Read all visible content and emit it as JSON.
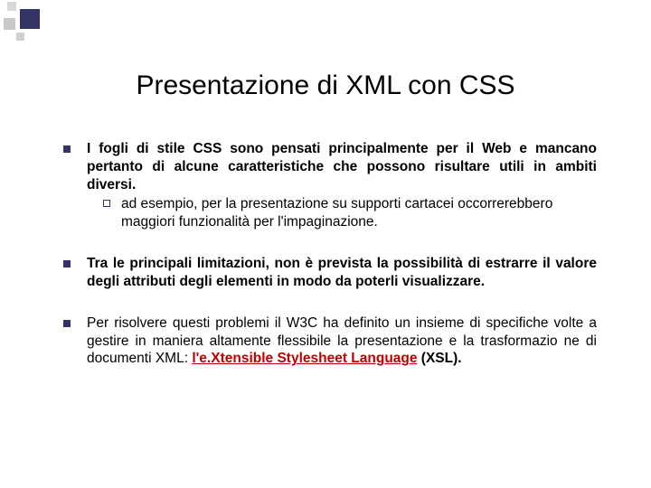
{
  "title": "Presentazione di XML con CSS",
  "items": {
    "b1": {
      "main": "I fogli di stile CSS sono pensati principalmente per il Web e mancano pertanto di alcune caratteristiche che possono risultare utili in ambiti diversi.",
      "sub": "ad esempio, per la presentazione su supporti cartacei occorrerebbero maggiori funzionalità per l'impaginazione."
    },
    "b2": {
      "main": "Tra le principali limitazioni, non è prevista la possibilità di estrarre il valore degli attributi degli elementi in modo da poterli visualizzare."
    },
    "b3": {
      "pre": "Per risolvere questi problemi il W3C ha definito un insieme di specifiche volte a gestire in maniera altamente flessibile la presentazione e la trasformazio ne di documenti XML: ",
      "highlight": "l'e.Xtensible Stylesheet Language",
      "post": " (XSL)."
    }
  }
}
